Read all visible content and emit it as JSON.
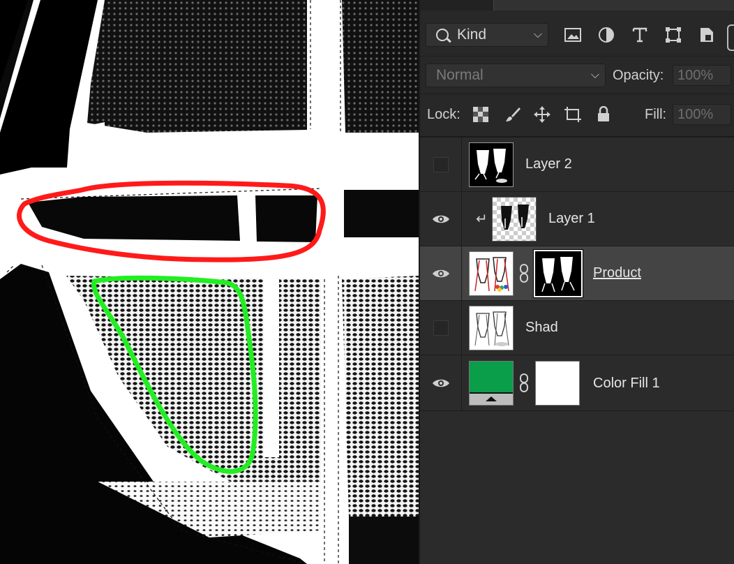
{
  "layers_panel": {
    "filter": {
      "label": "Kind"
    },
    "blend_mode": "Normal",
    "opacity": {
      "label": "Opacity:",
      "value": "100%"
    },
    "lock_label": "Lock:",
    "fill": {
      "label": "Fill:",
      "value": "100%"
    },
    "layers": [
      {
        "name": "Layer 2",
        "visible": false,
        "thumb": "black-mannequin-mask"
      },
      {
        "name": "Layer 1",
        "visible": true,
        "clipped": true,
        "thumb": "transparent-mannequin"
      },
      {
        "name": "Product",
        "visible": true,
        "selected": true,
        "has_mask": true,
        "thumb": "product-photo"
      },
      {
        "name": "Shad",
        "visible": false,
        "thumb": "shadow-photo"
      },
      {
        "name": "Color Fill 1",
        "visible": true,
        "has_mask": true,
        "thumb": "green-fill",
        "fill_color": "#0a9e4a"
      }
    ]
  },
  "canvas": {
    "annotations": [
      {
        "shape": "ellipse-outline",
        "color": "#ff1a1a"
      },
      {
        "shape": "loop-outline",
        "color": "#22ee22"
      }
    ]
  }
}
